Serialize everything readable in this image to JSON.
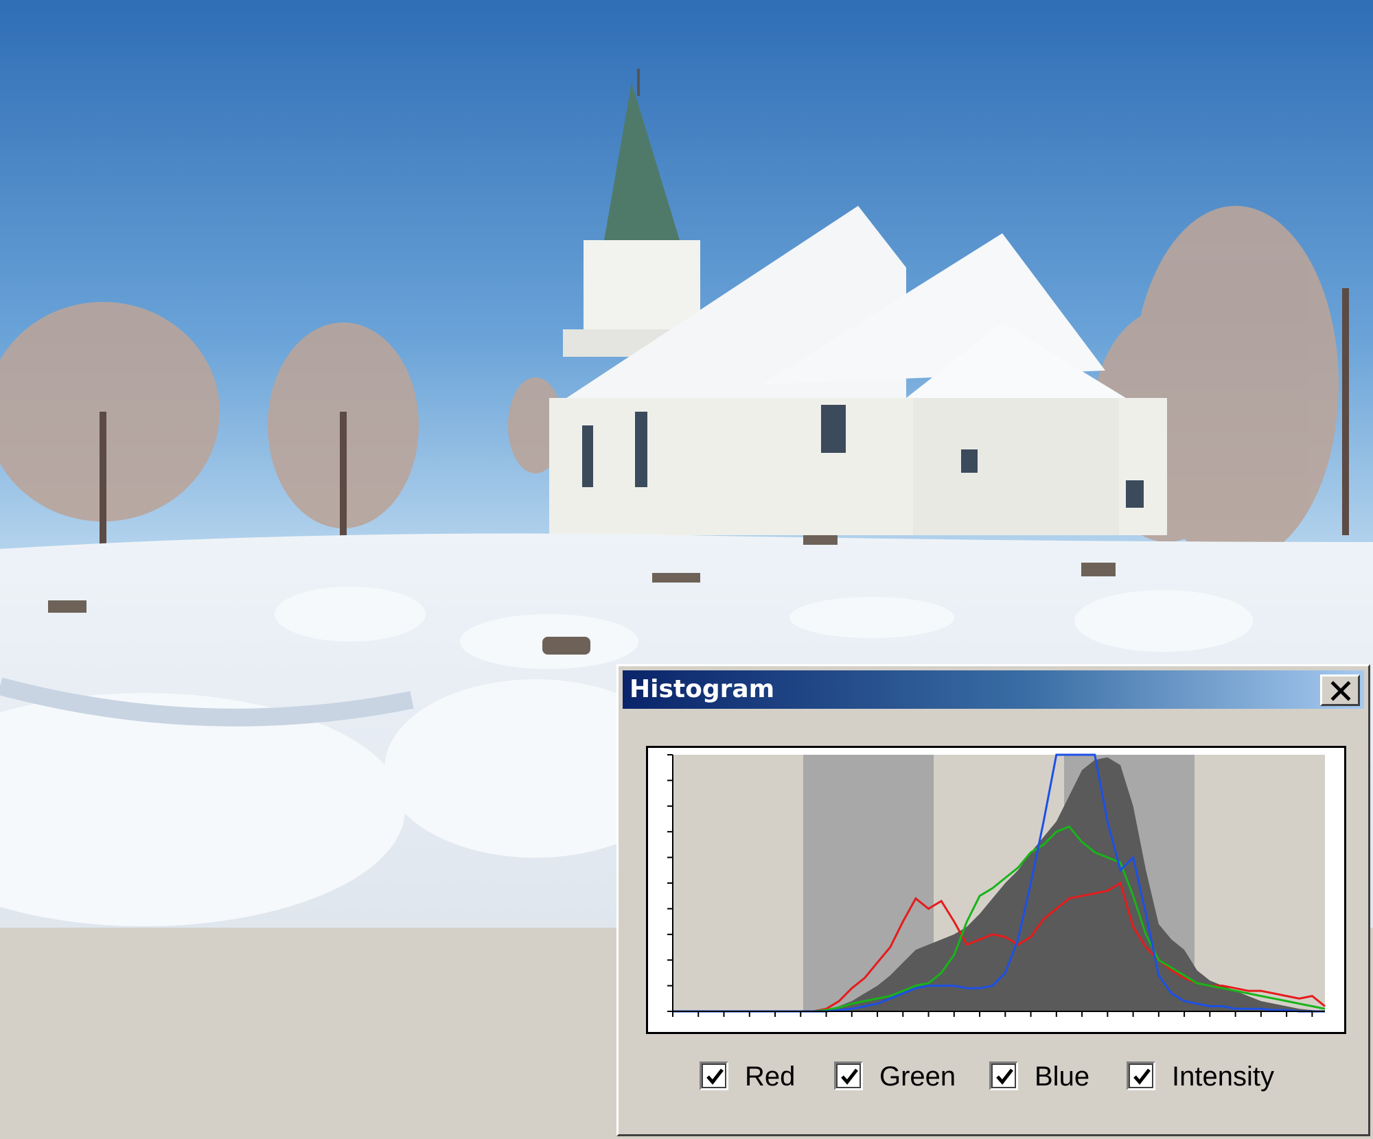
{
  "window": {
    "title": "Histogram",
    "close_icon": "close-icon"
  },
  "channels": [
    {
      "key": "red",
      "label": "Red",
      "checked": true,
      "color": "#e41c1c"
    },
    {
      "key": "green",
      "label": "Green",
      "checked": true,
      "color": "#18b418"
    },
    {
      "key": "blue",
      "label": "Blue",
      "checked": true,
      "color": "#1c50e6"
    },
    {
      "key": "intensity",
      "label": "Intensity",
      "checked": true,
      "color": "#5a5a5a"
    }
  ],
  "chart_data": {
    "type": "area",
    "xlim": [
      0,
      255
    ],
    "ylim": [
      0,
      100
    ],
    "grid": false,
    "highlight_bands": [
      [
        51,
        102
      ],
      [
        153,
        204
      ]
    ],
    "band_color": "#a8a8a8",
    "background_color": "#d4d0c8",
    "x": [
      0,
      20,
      40,
      55,
      60,
      65,
      70,
      75,
      80,
      85,
      90,
      95,
      100,
      105,
      110,
      115,
      120,
      125,
      130,
      135,
      140,
      145,
      150,
      155,
      160,
      165,
      170,
      175,
      180,
      185,
      190,
      195,
      200,
      205,
      210,
      215,
      220,
      225,
      230,
      235,
      240,
      245,
      250,
      255
    ],
    "series": [
      {
        "name": "Intensity",
        "values": [
          0,
          0,
          0,
          0,
          0.5,
          2,
          4,
          7,
          10,
          14,
          19,
          24,
          26,
          28,
          30,
          33,
          38,
          44,
          50,
          55,
          62,
          68,
          74,
          84,
          94,
          98,
          99,
          96,
          80,
          55,
          34,
          28,
          24,
          16,
          12,
          10,
          8,
          6,
          4,
          3,
          2,
          1,
          0.5,
          0
        ]
      },
      {
        "name": "Red",
        "values": [
          0,
          0,
          0,
          0,
          1,
          4,
          9,
          13,
          19,
          25,
          35,
          44,
          40,
          43,
          35,
          26,
          28,
          30,
          29,
          26,
          29,
          36,
          40,
          44,
          45,
          46,
          47,
          50,
          33,
          25,
          20,
          16,
          13,
          11,
          10,
          10,
          9,
          8,
          8,
          7,
          6,
          5,
          6,
          2
        ]
      },
      {
        "name": "Green",
        "values": [
          0,
          0,
          0,
          0,
          0.5,
          1.5,
          3,
          4,
          5,
          6,
          8,
          10,
          11,
          15,
          22,
          35,
          45,
          48,
          52,
          56,
          62,
          65,
          70,
          72,
          66,
          62,
          60,
          58,
          45,
          30,
          20,
          17,
          14,
          11,
          10,
          9,
          8,
          7,
          6,
          5,
          4,
          3,
          2,
          1
        ]
      },
      {
        "name": "Blue",
        "values": [
          0,
          0,
          0,
          0,
          0,
          0.5,
          1,
          2,
          3,
          5,
          7,
          9,
          10,
          10,
          10,
          9,
          9,
          10,
          15,
          28,
          50,
          74,
          100,
          100,
          100,
          100,
          74,
          55,
          60,
          38,
          14,
          7,
          4,
          3,
          2,
          2,
          1,
          1,
          1,
          0.5,
          0.5,
          0,
          0,
          0
        ]
      }
    ]
  }
}
